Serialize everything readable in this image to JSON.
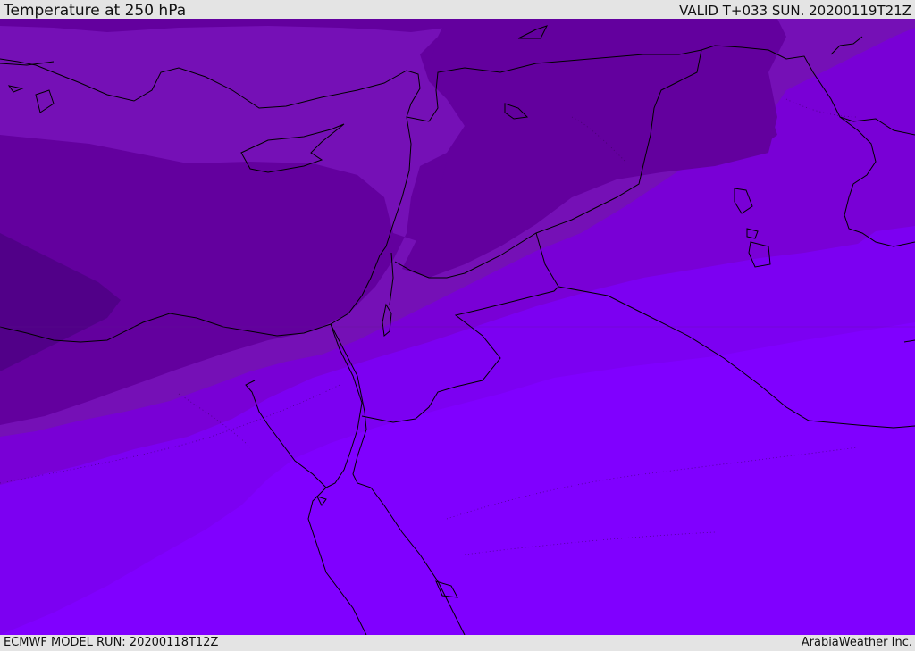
{
  "header": {
    "title": "Temperature at 250 hPa",
    "valid": "VALID T+033 SUN. 20200119T21Z"
  },
  "footer": {
    "model_run": "ECMWF MODEL RUN: 20200118T12Z",
    "credit": "ArabiaWeather Inc."
  },
  "map": {
    "variable": "temperature",
    "level": "250 hPa",
    "colors": {
      "coldest": "#510088",
      "cold": "#63009e",
      "cool": "#7510b6",
      "mild": "#7900d6",
      "warm": "#7c00f2",
      "warmest": "#8000ff",
      "coastline": "#000000"
    }
  }
}
